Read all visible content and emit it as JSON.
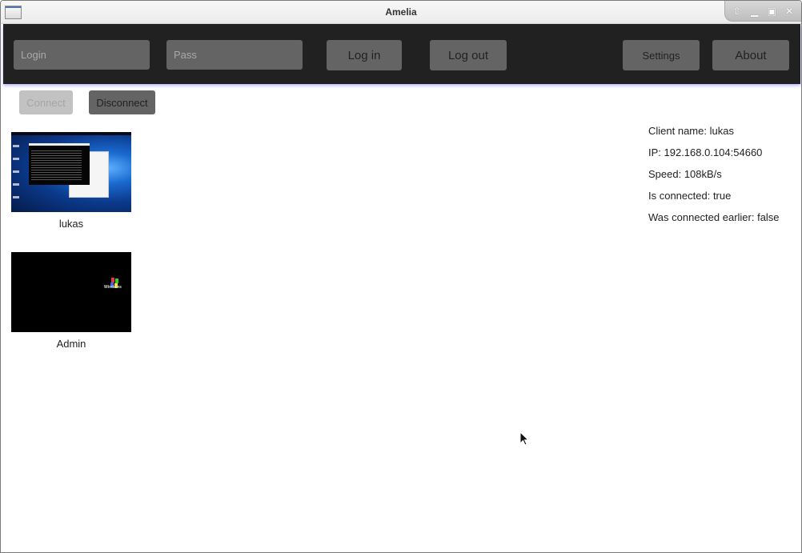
{
  "window": {
    "title": "Amelia",
    "controls": [
      "shade-icon",
      "minimize-icon",
      "maximize-icon",
      "close-icon"
    ]
  },
  "toolbar": {
    "login_placeholder": "Login",
    "login_value": "",
    "pass_placeholder": "Pass",
    "pass_value": "",
    "login_button": "Log in",
    "logout_button": "Log out",
    "settings_button": "Settings",
    "about_button": "About"
  },
  "connection": {
    "connect_label": "Connect",
    "connect_enabled": false,
    "disconnect_label": "Disconnect",
    "disconnect_enabled": true
  },
  "clients": [
    {
      "name": "lukas",
      "thumbnail": "windows-10-desktop-with-terminal"
    },
    {
      "name": "Admin",
      "thumbnail": "windows-xp-black-screen"
    }
  ],
  "details": {
    "client_name": "Client name: lukas",
    "ip": "IP: 192.168.0.104:54660",
    "speed": "Speed: 108kB/s",
    "is_connected": "Is connected: true",
    "was_connected": "Was connected earlier: false"
  },
  "colors": {
    "toolbar_bg": "#212121",
    "button_bg": "#646464",
    "button_disabled_bg": "#c2c2c2",
    "toolbar_glow": "#7878ff"
  }
}
